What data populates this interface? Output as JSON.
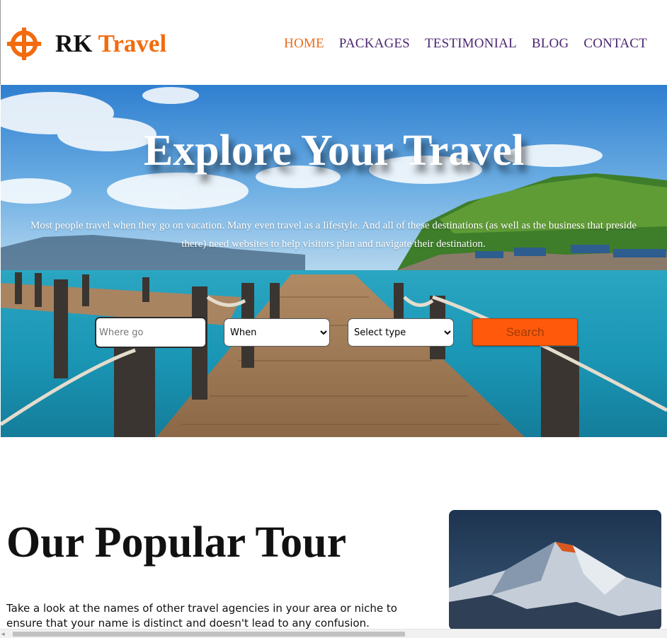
{
  "brand": {
    "name_dark": "RK",
    "name_accent": "Travel",
    "icon": "compass-cross-icon"
  },
  "nav": {
    "items": [
      {
        "label": "HOME",
        "active": true
      },
      {
        "label": "PACKAGES",
        "active": false
      },
      {
        "label": "TESTIMONIAL",
        "active": false
      },
      {
        "label": "BLOG",
        "active": false
      },
      {
        "label": "CONTACT",
        "active": false
      }
    ]
  },
  "hero": {
    "title": "Explore Your Travel",
    "text": "Most people travel when they go on vacation. Many even travel as a lifestyle. And all of these destinations (as well as the business that preside there) need websites to help visitors plan and navigate their destination."
  },
  "search": {
    "where_placeholder": "Where go",
    "when_selected": "When",
    "type_selected": "Select type",
    "button_label": "Search"
  },
  "tour": {
    "title": "Our Popular Tour",
    "text": "Take a look at the names of other travel agencies in your area or niche to ensure that your name is distinct and doesn't lead to any confusion."
  },
  "colors": {
    "accent": "#f26b0f",
    "nav": "#4b2671",
    "button": "#ff5a0b"
  }
}
